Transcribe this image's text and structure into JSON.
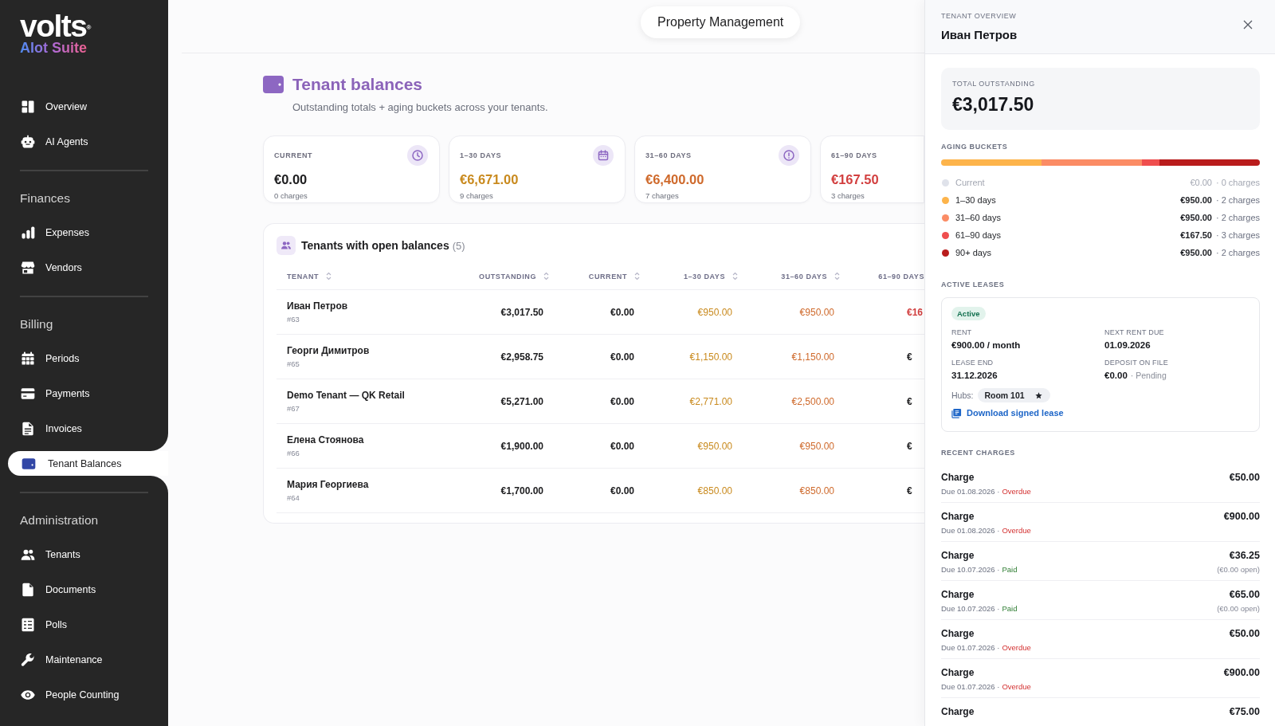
{
  "sidebar": {
    "logo": {
      "name": "volts$^{®}$",
      "tagline": "AIot Suite"
    },
    "sections": [
      {
        "items": [
          {
            "label": "Overview",
            "selected": false
          },
          {
            "label": "AI Agents",
            "selected": false
          }
        ]
      },
      {
        "heading": "Finances",
        "items": [
          {
            "label": "Expenses",
            "selected": false
          },
          {
            "label": "Vendors",
            "selected": false
          }
        ]
      },
      {
        "heading": "Billing",
        "items": [
          {
            "label": "Periods",
            "selected": false
          },
          {
            "label": "Payments",
            "selected": false
          },
          {
            "label": "Invoices",
            "selected": false
          },
          {
            "label": "Tenant Balances",
            "selected": true
          }
        ]
      },
      {
        "heading": "Administration",
        "items": [
          {
            "label": "Tenants",
            "selected": false
          },
          {
            "label": "Documents",
            "selected": false
          },
          {
            "label": "Polls",
            "selected": false
          },
          {
            "label": "Maintenance",
            "selected": false
          },
          {
            "label": "People Counting",
            "selected": false
          }
        ]
      }
    ]
  },
  "header": {
    "title": "Property Management"
  },
  "page": {
    "title": "Tenant balances",
    "subtitle": "Outstanding totals + aging buckets across your tenants."
  },
  "cards": [
    {
      "label": "CURRENT",
      "value": "€0.00",
      "count": "0 charges",
      "color": "#1d1d1f"
    },
    {
      "label": "1–30 DAYS",
      "value": "€6,671.00",
      "count": "9 charges",
      "color": "#c98a1e"
    },
    {
      "label": "31–60 DAYS",
      "value": "€6,400.00",
      "count": "7 charges",
      "color": "#cf6a2c"
    },
    {
      "label": "61–90 DAYS",
      "value": "€167.50",
      "count": "3 charges",
      "color": "#d23f3f"
    }
  ],
  "table": {
    "title": "Tenants with open balances",
    "count": "(5)",
    "columns": [
      {
        "label": "TENANT",
        "sortable": true
      },
      {
        "label": "OUTSTANDING",
        "sortable": true
      },
      {
        "label": "CURRENT",
        "sortable": true
      },
      {
        "label": "1–30 DAYS",
        "sortable": true
      },
      {
        "label": "31–60 DAYS",
        "sortable": true
      },
      {
        "label": "61–90 DAYS",
        "sortable": false
      }
    ],
    "rows": [
      {
        "cells": [
          {
            "text": "Иван Петров",
            "sub": "#63"
          },
          {
            "text": "€3,017.50",
            "color": "#1d1d1f"
          },
          {
            "text": "€0.00",
            "color": "#1d1d1f"
          },
          {
            "text": "€950.00",
            "color": "#c98a1e"
          },
          {
            "text": "€950.00",
            "color": "#cf6a2c"
          },
          {
            "text": "€16",
            "color": "#d23f3f"
          }
        ]
      },
      {
        "cells": [
          {
            "text": "Георги Димитров",
            "sub": "#65"
          },
          {
            "text": "€2,958.75",
            "color": "#1d1d1f"
          },
          {
            "text": "€0.00",
            "color": "#1d1d1f"
          },
          {
            "text": "€1,150.00",
            "color": "#c98a1e"
          },
          {
            "text": "€1,150.00",
            "color": "#cf6a2c"
          },
          {
            "text": "€",
            "color": "#1d1d1f"
          }
        ]
      },
      {
        "cells": [
          {
            "text": "Demo Tenant — QK Retail",
            "sub": "#67"
          },
          {
            "text": "€5,271.00",
            "color": "#1d1d1f"
          },
          {
            "text": "€0.00",
            "color": "#1d1d1f"
          },
          {
            "text": "€2,771.00",
            "color": "#c98a1e"
          },
          {
            "text": "€2,500.00",
            "color": "#cf6a2c"
          },
          {
            "text": "€",
            "color": "#1d1d1f"
          }
        ]
      },
      {
        "cells": [
          {
            "text": "Елена Стоянова",
            "sub": "#66"
          },
          {
            "text": "€1,900.00",
            "color": "#1d1d1f"
          },
          {
            "text": "€0.00",
            "color": "#1d1d1f"
          },
          {
            "text": "€950.00",
            "color": "#c98a1e"
          },
          {
            "text": "€950.00",
            "color": "#cf6a2c"
          },
          {
            "text": "€",
            "color": "#1d1d1f"
          }
        ]
      },
      {
        "cells": [
          {
            "text": "Мария Георгиева",
            "sub": "#64"
          },
          {
            "text": "€1,700.00",
            "color": "#1d1d1f"
          },
          {
            "text": "€0.00",
            "color": "#1d1d1f"
          },
          {
            "text": "€850.00",
            "color": "#c98a1e"
          },
          {
            "text": "€850.00",
            "color": "#cf6a2c"
          },
          {
            "text": "€",
            "color": "#1d1d1f"
          }
        ]
      }
    ]
  },
  "panel": {
    "eyebrow": "TENANT OVERVIEW",
    "title": "Иван Петров",
    "total": {
      "label": "TOTAL OUTSTANDING",
      "value": "€3,017.50"
    },
    "aging": {
      "title": "AGING BUCKETS",
      "buckets": [
        {
          "label": "Current",
          "amount": "€0.00",
          "count": "· 0 charges",
          "color": "#dfe2ea",
          "dimmed": true
        },
        {
          "label": "1–30 days",
          "amount": "€950.00",
          "count": "· 2 charges",
          "color": "#fdb44b",
          "dimmed": false
        },
        {
          "label": "31–60 days",
          "amount": "€950.00",
          "count": "· 2 charges",
          "color": "#fb8c65",
          "dimmed": false
        },
        {
          "label": "61–90 days",
          "amount": "€167.50",
          "count": "· 3 charges",
          "color": "#ef4e4e",
          "dimmed": false
        },
        {
          "label": "90+ days",
          "amount": "€950.00",
          "count": "· 2 charges",
          "color": "#b91c1c",
          "dimmed": false
        }
      ]
    },
    "leases": {
      "title": "ACTIVE LEASES",
      "items": [
        {
          "status": "Active",
          "fields": [
            {
              "label": "RENT",
              "value": "€900.00 / month"
            },
            {
              "label": "NEXT RENT DUE",
              "value": "01.09.2026"
            },
            {
              "label": "LEASE END",
              "value": "31.12.2026"
            },
            {
              "label": "DEPOSIT ON FILE",
              "value": "€0.00",
              "note": "· Pending"
            }
          ],
          "hubs_label": "Hubs:",
          "hubs": [
            {
              "name": "Room 101",
              "starred": true
            }
          ],
          "download": "Download signed lease"
        }
      ]
    },
    "charges": {
      "title": "RECENT CHARGES",
      "items": [
        {
          "title": "Charge",
          "due": "Due 01.08.2026 ·",
          "status": "Overdue",
          "kind": "overdue",
          "amount": "€50.00"
        },
        {
          "title": "Charge",
          "due": "Due 01.08.2026 ·",
          "status": "Overdue",
          "kind": "overdue",
          "amount": "€900.00"
        },
        {
          "title": "Charge",
          "due": "Due 10.07.2026 ·",
          "status": "Paid",
          "kind": "paid",
          "amount": "€36.25",
          "open": "(€0.00 open)"
        },
        {
          "title": "Charge",
          "due": "Due 10.07.2026 ·",
          "status": "Paid",
          "kind": "paid",
          "amount": "€65.00",
          "open": "(€0.00 open)"
        },
        {
          "title": "Charge",
          "due": "Due 01.07.2026 ·",
          "status": "Overdue",
          "kind": "overdue",
          "amount": "€50.00"
        },
        {
          "title": "Charge",
          "due": "Due 01.07.2026 ·",
          "status": "Overdue",
          "kind": "overdue",
          "amount": "€900.00"
        },
        {
          "title": "Charge",
          "amount": "€75.00"
        }
      ]
    }
  }
}
